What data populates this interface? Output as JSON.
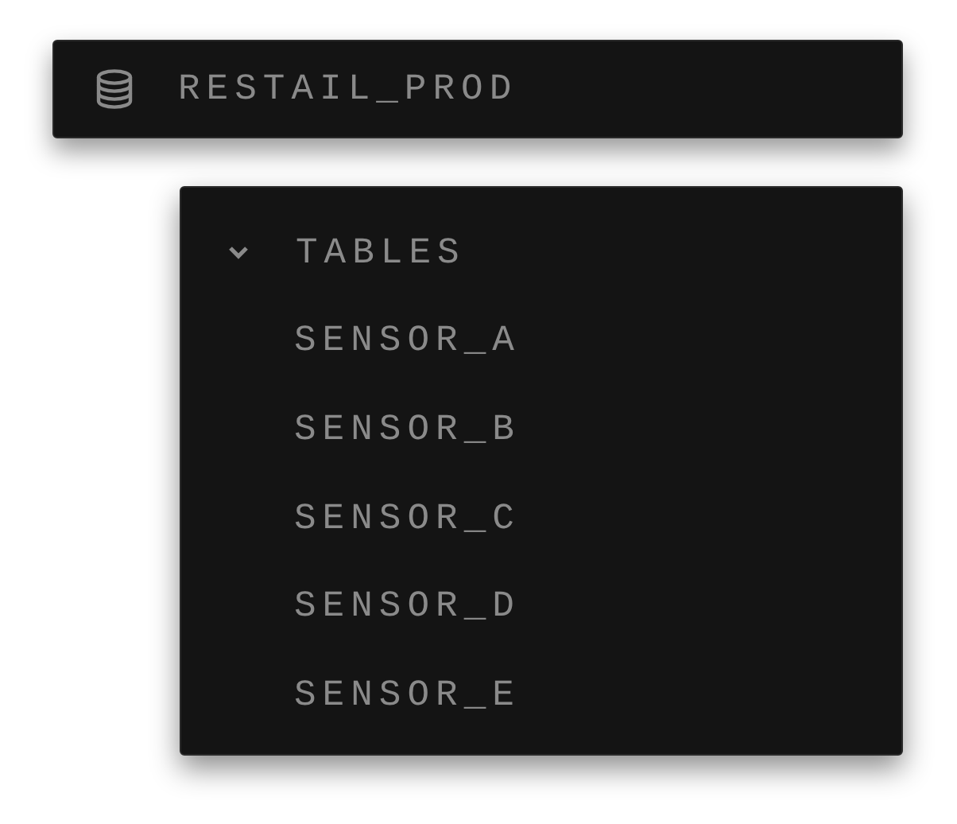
{
  "database": {
    "name": "RESTAIL_PROD"
  },
  "tree": {
    "label": "TABLES",
    "expanded": true,
    "children": [
      {
        "label": "SENSOR_A"
      },
      {
        "label": "SENSOR_B"
      },
      {
        "label": "SENSOR_C"
      },
      {
        "label": "SENSOR_D"
      },
      {
        "label": "SENSOR_E"
      }
    ]
  }
}
